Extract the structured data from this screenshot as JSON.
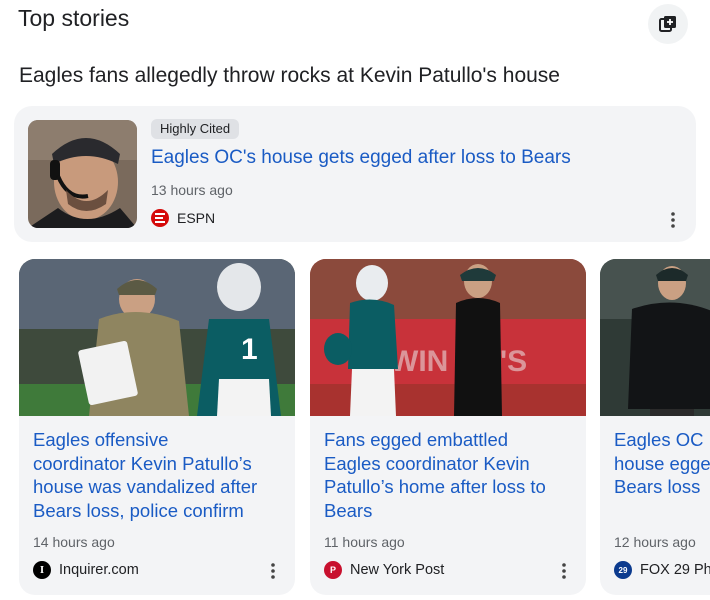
{
  "section": {
    "title": "Top stories",
    "action_icon": "add-to-collection-icon"
  },
  "topic": {
    "heading": "Eagles fans allegedly throw rocks at Kevin Patullo's house"
  },
  "featured": {
    "badge": "Highly Cited",
    "headline": "Eagles OC's house gets egged after loss to Bears",
    "time": "13 hours ago",
    "source": "ESPN",
    "source_color": "#d50a0a",
    "thumbnail_icon": "coach-headset-photo"
  },
  "cards": [
    {
      "headline_lines": [
        "Eagles offensive",
        "coordinator Kevin Patullo’s",
        "house was vandalized after",
        "Bears loss, police confirm"
      ],
      "time": "14 hours ago",
      "source": "Inquirer.com",
      "source_color": "#000000",
      "image_icon": "coach-on-sideline-photo"
    },
    {
      "headline_lines": [
        "Fans egged embattled",
        "Eagles coordinator Kevin",
        "Patullo’s home after loss to",
        "Bears"
      ],
      "time": "11 hours ago",
      "source": "New York Post",
      "source_color": "#c8102e",
      "image_icon": "quarterback-and-coach-photo"
    },
    {
      "headline_lines": [
        "Eagles OC",
        "house egge",
        "Bears loss"
      ],
      "time": "12 hours ago",
      "source": "FOX 29 Phi",
      "source_color": "#0b3a8e",
      "image_icon": "coach-in-jacket-photo"
    }
  ]
}
